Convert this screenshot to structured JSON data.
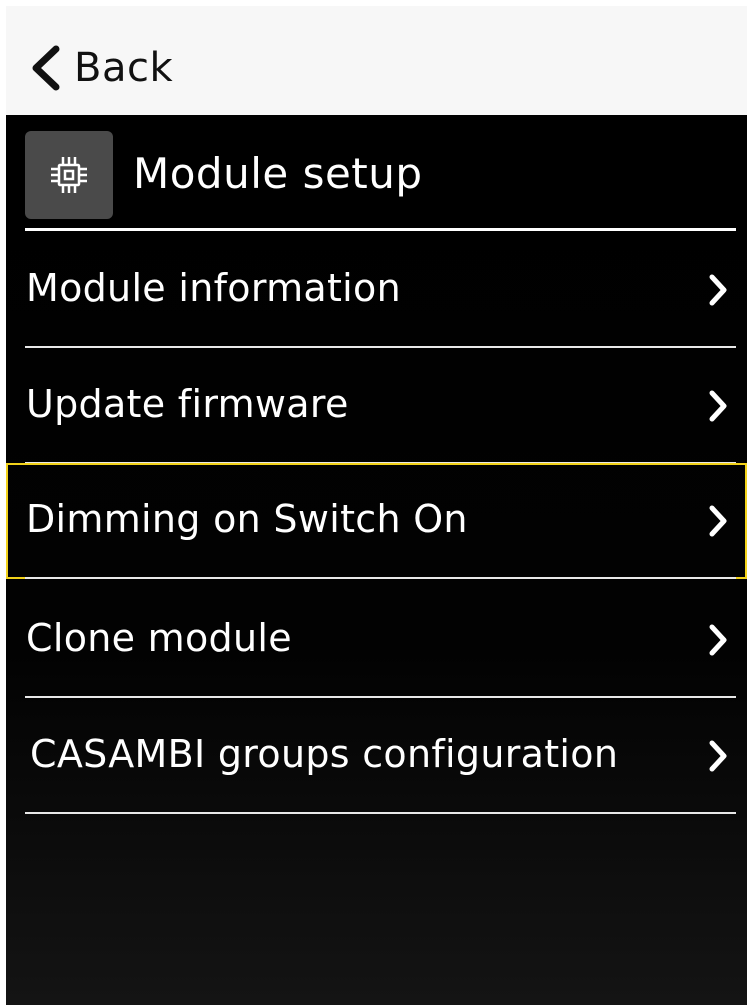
{
  "header": {
    "back_label": "Back"
  },
  "page": {
    "title": "Module setup",
    "title_icon": "chip-icon"
  },
  "menu": {
    "items": [
      {
        "label": "Module information",
        "icon": "chevron-right-icon",
        "selected": false
      },
      {
        "label": "Update firmware",
        "icon": "chevron-right-icon",
        "selected": false
      },
      {
        "label": "Dimming on Switch On",
        "icon": "chevron-right-icon",
        "selected": true
      },
      {
        "label": "Clone module",
        "icon": "chevron-right-icon",
        "selected": false
      },
      {
        "label": "CASAMBI groups configuration",
        "icon": "chevron-right-icon",
        "selected": false
      }
    ]
  },
  "colors": {
    "header_bg": "#f7f7f7",
    "screen_bg": "#000000",
    "icon_box_bg": "#4a4a4a",
    "selection_outline": "#f2d21a",
    "text_light": "#ffffff",
    "text_dark": "#111111"
  }
}
